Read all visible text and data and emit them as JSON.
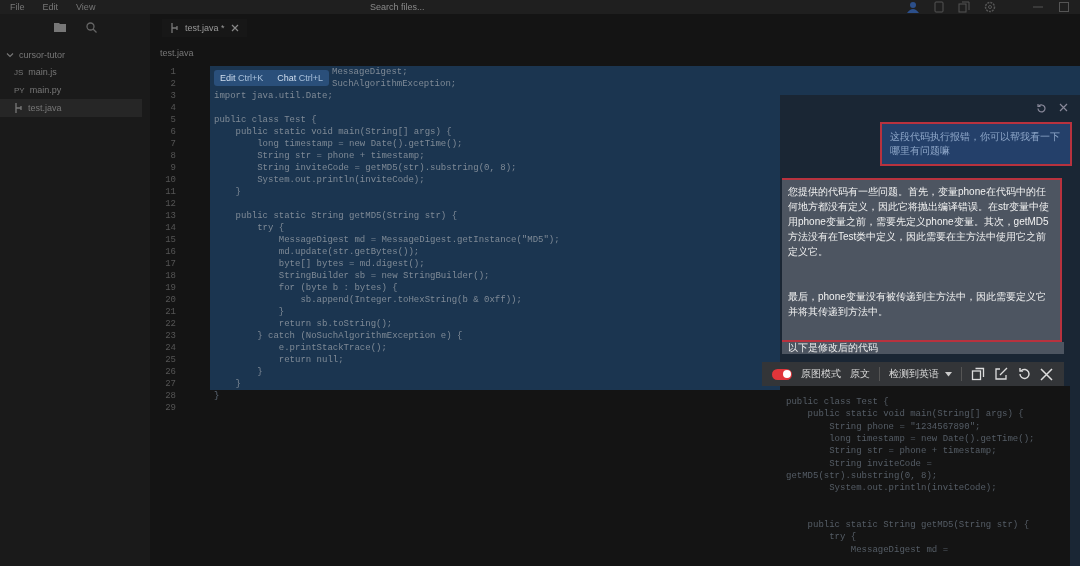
{
  "menu": [
    "File",
    "Edit",
    "View"
  ],
  "search": {
    "placeholder": "Search files..."
  },
  "sidebar": {
    "tree": [
      {
        "label": "cursor-tutor",
        "expanded": true,
        "children": [
          {
            "label": "main.js",
            "badge": "JS",
            "selected": false
          },
          {
            "label": "main.py",
            "badge": "PY",
            "selected": false
          },
          {
            "label": "test.java",
            "selected": true
          }
        ]
      }
    ]
  },
  "tabs": [
    {
      "label": "test.java *",
      "selected": true
    }
  ],
  "breadcrumb": "test.java",
  "inline_popup": {
    "items": [
      {
        "label": "Edit",
        "shortcut": "Ctrl+K"
      },
      {
        "label": "Chat",
        "shortcut": "Ctrl+L"
      }
    ]
  },
  "code": [
    {
      "n": "1",
      "text": "MessageDigest;",
      "kind": "covered",
      "selected": true
    },
    {
      "n": "2",
      "text": "SuchAlgorithmException;",
      "kind": "covered",
      "selected": true
    },
    {
      "n": "3",
      "text": "import java.util.Date;",
      "kind": "plain",
      "selected": true
    },
    {
      "n": "4",
      "kind": "plain",
      "selected": true
    },
    {
      "n": "5",
      "text": "public class Test {",
      "kind": "plain",
      "selected": true
    },
    {
      "n": "6",
      "text": "    public static void main(String[] args) {",
      "kind": "plain",
      "selected": true
    },
    {
      "n": "7",
      "text": "        long timestamp = new Date().getTime();",
      "kind": "plain",
      "selected": true
    },
    {
      "n": "8",
      "text": "        String str = phone + timestamp;",
      "kind": "plain",
      "selected": true
    },
    {
      "n": "9",
      "text": "        String inviteCode = getMD5(str).substring(0, 8);",
      "kind": "plain",
      "selected": true
    },
    {
      "n": "10",
      "text": "        System.out.println(inviteCode);",
      "kind": "plain",
      "selected": true
    },
    {
      "n": "11",
      "text": "    }",
      "kind": "plain",
      "selected": true
    },
    {
      "n": "12",
      "kind": "plain",
      "selected": true
    },
    {
      "n": "13",
      "text": "    public static String getMD5(String str) {",
      "kind": "plain",
      "selected": true
    },
    {
      "n": "14",
      "text": "        try {",
      "kind": "plain",
      "selected": true
    },
    {
      "n": "15",
      "text": "            MessageDigest md = MessageDigest.getInstance(\"MD5\");",
      "kind": "plain",
      "selected": true
    },
    {
      "n": "16",
      "text": "            md.update(str.getBytes());",
      "kind": "plain",
      "selected": true
    },
    {
      "n": "17",
      "text": "            byte[] bytes = md.digest();",
      "kind": "plain",
      "selected": true
    },
    {
      "n": "18",
      "text": "            StringBuilder sb = new StringBuilder();",
      "kind": "plain",
      "selected": true
    },
    {
      "n": "19",
      "text": "            for (byte b : bytes) {",
      "kind": "plain",
      "selected": true
    },
    {
      "n": "20",
      "text": "                sb.append(Integer.toHexString(b & 0xff));",
      "kind": "plain",
      "selected": true
    },
    {
      "n": "21",
      "text": "            }",
      "kind": "plain",
      "selected": true
    },
    {
      "n": "22",
      "text": "            return sb.toString();",
      "kind": "plain",
      "selected": true
    },
    {
      "n": "23",
      "text": "        } catch (NoSuchAlgorithmException e) {",
      "kind": "plain",
      "selected": true
    },
    {
      "n": "24",
      "text": "            e.printStackTrace();",
      "kind": "plain",
      "selected": true
    },
    {
      "n": "25",
      "text": "            return null;",
      "kind": "plain",
      "selected": true
    },
    {
      "n": "26",
      "text": "        }",
      "kind": "plain",
      "selected": true
    },
    {
      "n": "27",
      "text": "    }",
      "kind": "plain",
      "selected": true
    },
    {
      "n": "28",
      "text": "}",
      "kind": "plain",
      "selected": false
    },
    {
      "n": "29",
      "kind": "plain",
      "selected": false
    }
  ],
  "chat": {
    "user_message": "这段代码执行报错，你可以帮我看一下哪里有问题嘛",
    "reply": [
      "您提供的代码有一些问题。首先，变量phone在代码中的任何地方都没有定义，因此它将抛出编译错误。在str变量中使用phone变量之前，需要先定义phone变量。其次，getMD5方法没有在Test类中定义，因此需要在主方法中使用它之前定义它。",
      "最后，phone变量没有被传递到主方法中，因此需要定义它并将其传递到方法中。"
    ],
    "caption": "以下是修改后的代码",
    "code": [
      {
        "text": "public class Test {"
      },
      {
        "text": "    public static void main(String[] args) {"
      },
      {
        "text": "        String phone = \"1234567890\";"
      },
      {
        "text": "        long timestamp = new Date().getTime();"
      },
      {
        "text": "        String str = phone + timestamp;"
      },
      {
        "text": "        String inviteCode ="
      },
      {
        "text": "getMD5(str).substring(0, 8);"
      },
      {
        "text": "        System.out.println(inviteCode);"
      },
      {
        "text": "    public static String getMD5(String str) {",
        "gap_before": true
      },
      {
        "text": "        try {"
      },
      {
        "text": "            MessageDigest md ="
      }
    ]
  },
  "translator": {
    "mode_toggle": {
      "label": "原图模式",
      "on": true
    },
    "original": "原文",
    "language": "检测到英语"
  }
}
